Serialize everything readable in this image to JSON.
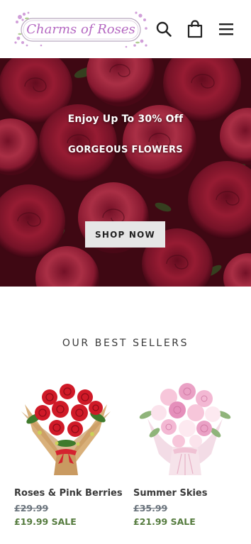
{
  "header": {
    "logo_text": "Charms of Roses",
    "icons": [
      "search-icon",
      "cart-icon",
      "menu-icon"
    ]
  },
  "hero": {
    "title": "Enjoy Up To 30% Off",
    "subtitle": "GORGEOUS FLOWERS",
    "button_label": "SHOP NOW"
  },
  "best_sellers": {
    "heading": "OUR BEST SELLERS",
    "products": [
      {
        "name": "Roses & Pink Berries",
        "old_price": "£29.99",
        "sale_price": "£19.99 SALE"
      },
      {
        "name": "Summer Skies",
        "old_price": "£35.99",
        "sale_price": "£21.99 SALE"
      }
    ]
  },
  "colors": {
    "text": "#3a3a3a",
    "sale_green": "#557b3e",
    "strike_grey": "#69727b",
    "button_bg": "#e6e6e6",
    "logo_purple": "#b569c2"
  }
}
